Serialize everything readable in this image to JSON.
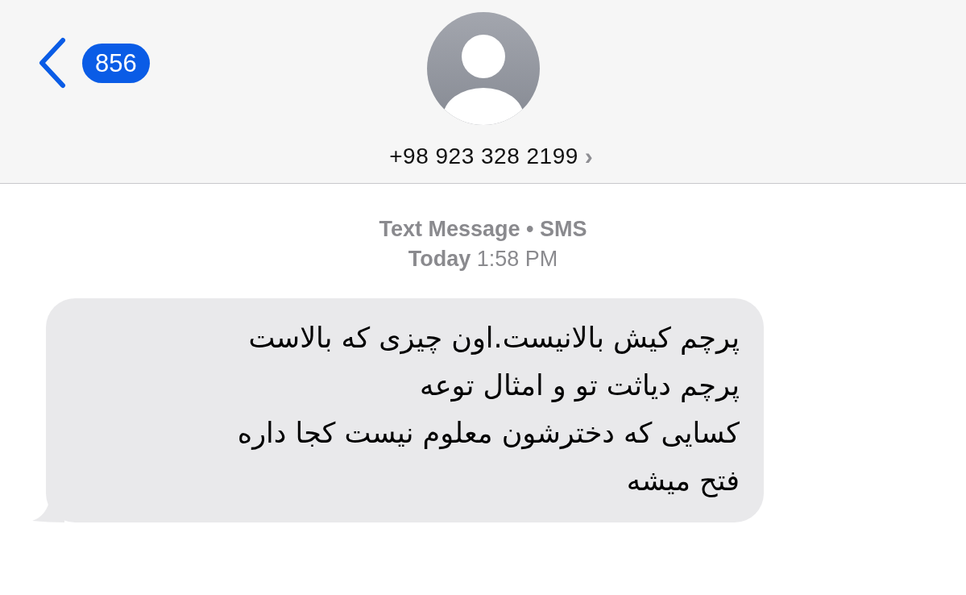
{
  "header": {
    "back_badge": "856",
    "contact": "+98 923 328 2199",
    "contact_chevron": "›"
  },
  "thread": {
    "service": "Text Message • SMS",
    "timestamp": "**Today** 1:58 PM"
  },
  "messages": [
    {
      "kind": "incoming",
      "text": "پرچم کیش بالانیست.اون چیزی که بالاست\nپرچم دیاثت تو و امثال توعه\nکسایی که دخترشون معلوم نیست کجا داره\nفتح میشه"
    }
  ]
}
